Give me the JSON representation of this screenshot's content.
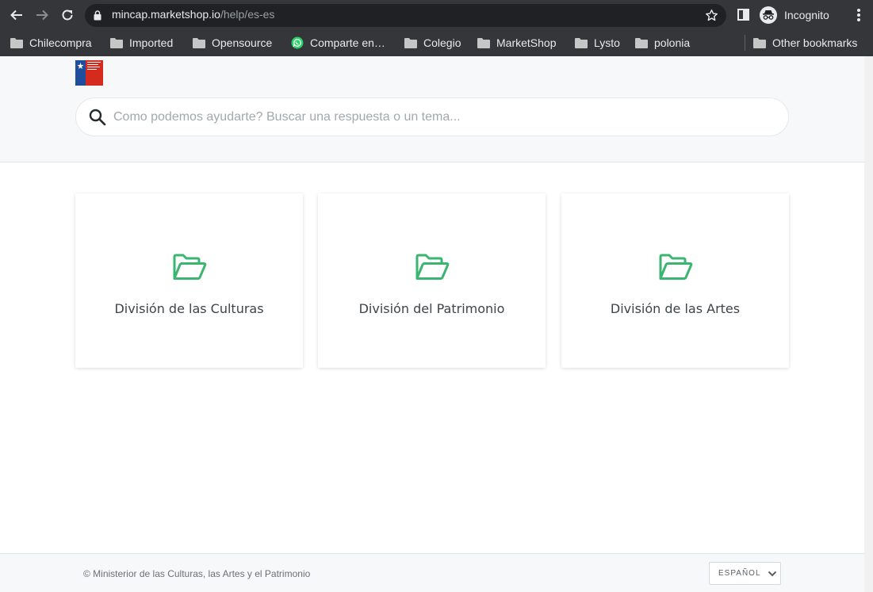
{
  "browser": {
    "url_host": "mincap.marketshop.io",
    "url_path": "/help/es-es",
    "profile_label": "Incognito",
    "bookmarks": [
      {
        "label": "Chilecompra",
        "icon": "folder-icon"
      },
      {
        "label": "Imported",
        "icon": "folder-icon"
      },
      {
        "label": "Opensource",
        "icon": "folder-icon"
      },
      {
        "label": "Comparte en…",
        "icon": "whatsapp-icon"
      },
      {
        "label": "Colegio",
        "icon": "folder-icon"
      },
      {
        "label": "MarketShop",
        "icon": "folder-icon"
      },
      {
        "label": "Lysto",
        "icon": "folder-icon"
      },
      {
        "label": "polonia",
        "icon": "folder-icon"
      }
    ],
    "other_bookmarks": "Other bookmarks"
  },
  "search": {
    "placeholder": "Como podemos ayudarte? Buscar una respuesta o un tema..."
  },
  "categories": [
    {
      "title": "División de las Culturas",
      "icon": "folder-open-icon"
    },
    {
      "title": "División del Patrimonio",
      "icon": "folder-open-icon"
    },
    {
      "title": "División de las Artes",
      "icon": "folder-open-icon"
    }
  ],
  "footer": {
    "copyright": "© Ministerior de las Culturas, las Artes y el Patrimonio",
    "language": "ESPAÑOL"
  },
  "colors": {
    "accent": "#3bb56f",
    "chrome_bg": "#35363a",
    "flag_blue": "#1f4e9c",
    "flag_red": "#d52b1e"
  }
}
